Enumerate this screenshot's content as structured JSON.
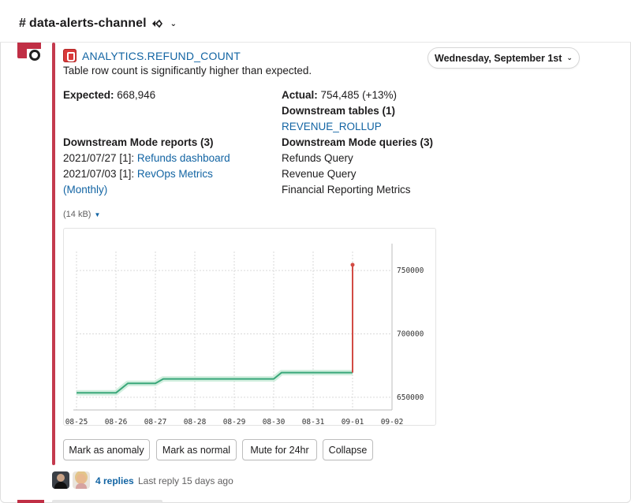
{
  "header": {
    "channel_hash": "#",
    "channel_name": "data-alerts-channel"
  },
  "date_divider": {
    "label": "Wednesday, September 1st"
  },
  "alert": {
    "title": "ANALYTICS.REFUND_COUNT",
    "description": "Table row count is significantly higher than expected.",
    "expected_label": "Expected:",
    "expected_value": "668,946",
    "actual_label": "Actual:",
    "actual_value": "754,485",
    "actual_change": "(+13%)",
    "downstream_tables_label": "Downstream tables (1)",
    "downstream_tables": [
      "REVENUE_ROLLUP"
    ],
    "mode_reports_label": "Downstream Mode reports (3)",
    "mode_reports": [
      {
        "prefix": "2021/07/27 [1]:",
        "link": "Refunds dashboard"
      },
      {
        "prefix": "2021/07/03 [1]:",
        "link": "RevOps Metrics"
      },
      {
        "prefix": "",
        "link": "(Monthly)"
      }
    ],
    "mode_queries_label": "Downstream Mode queries (3)",
    "mode_queries": [
      "Refunds Query",
      "Revenue Query",
      "Financial Reporting Metrics"
    ],
    "attachment_size": "(14 kB)"
  },
  "chart_data": {
    "type": "line",
    "x": [
      "08-25",
      "08-26",
      "08-27",
      "08-28",
      "08-29",
      "08-30",
      "08-31",
      "09-01",
      "09-02"
    ],
    "ytick_labels": [
      "650000",
      "700000",
      "750000"
    ],
    "ylim": [
      640000,
      765000
    ],
    "grid": true,
    "series": [
      {
        "color": "#3aa77a",
        "points": [
          [
            "08-25",
            653500
          ],
          [
            "08-26",
            653500
          ],
          [
            "08-26.3",
            661000
          ],
          [
            "08-27",
            661000
          ],
          [
            "08-27.2",
            664500
          ],
          [
            "08-30",
            664500
          ],
          [
            "08-30.2",
            669500
          ],
          [
            "09-01",
            669500
          ]
        ]
      },
      {
        "color": "#d24b44",
        "points": [
          [
            "09-01",
            669500
          ],
          [
            "09-01",
            754485
          ]
        ]
      }
    ]
  },
  "actions": {
    "mark_anomaly": "Mark as anomaly",
    "mark_normal": "Mark as normal",
    "mute": "Mute for 24hr",
    "collapse": "Collapse"
  },
  "thread": {
    "replies": "4 replies",
    "last_reply": "Last reply 15 days ago"
  },
  "colors": {
    "link": "#1264a3",
    "alert_bar": "#c43a4e",
    "normal_line": "#3aa77a",
    "anomaly_line": "#d24b44"
  }
}
